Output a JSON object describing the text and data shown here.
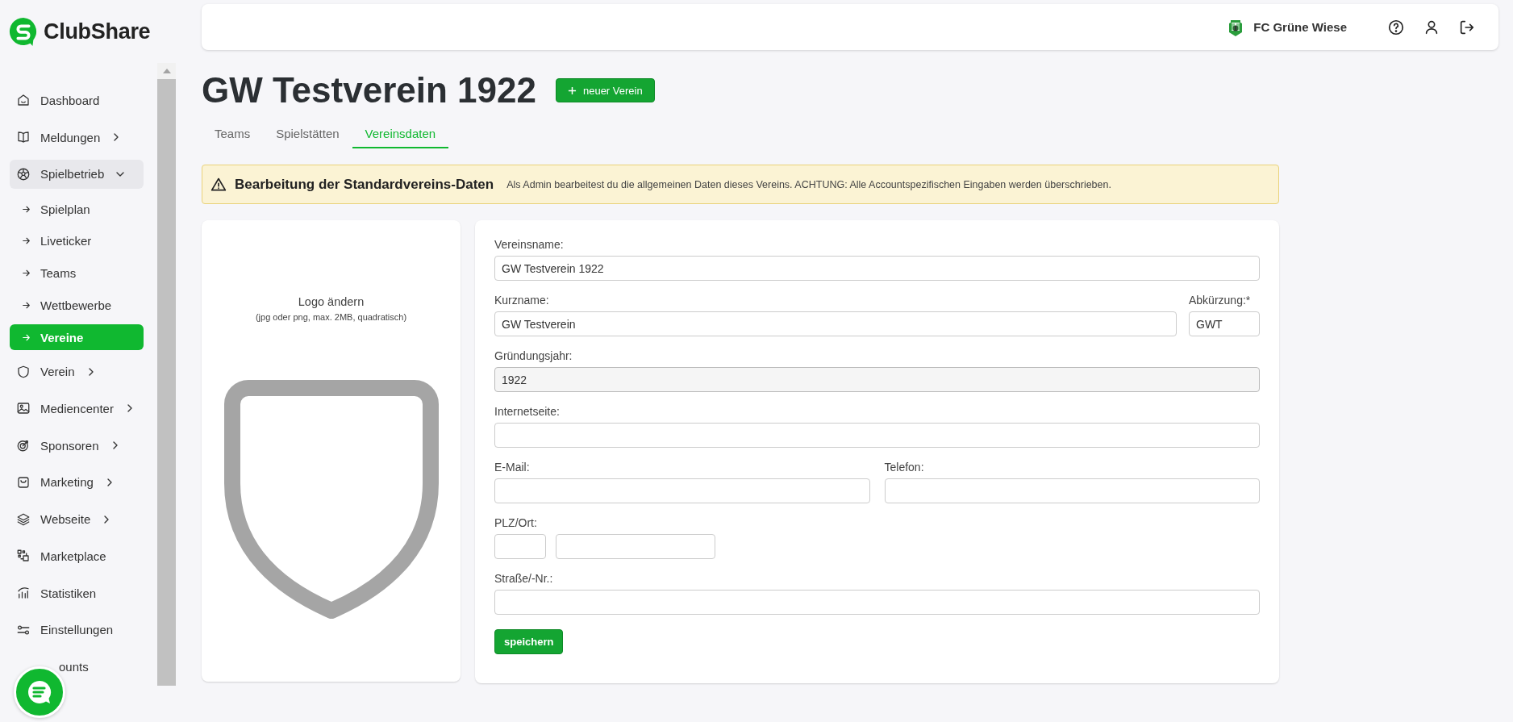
{
  "brand": {
    "name": "ClubShare"
  },
  "header": {
    "club": "FC Grüne Wiese"
  },
  "sidebar": {
    "items": [
      {
        "label": "Dashboard",
        "selected": false
      },
      {
        "label": "Meldungen",
        "selected": false,
        "expanded": false
      },
      {
        "label": "Spielbetrieb",
        "selected": false,
        "expanded": true,
        "children": [
          {
            "label": "Spielplan",
            "selected": false
          },
          {
            "label": "Liveticker",
            "selected": false
          },
          {
            "label": "Teams",
            "selected": false
          },
          {
            "label": "Wettbewerbe",
            "selected": false
          },
          {
            "label": "Vereine",
            "selected": true
          }
        ]
      },
      {
        "label": "Verein",
        "selected": false,
        "expanded": false
      },
      {
        "label": "Mediencenter",
        "selected": false,
        "expanded": false
      },
      {
        "label": "Sponsoren",
        "selected": false,
        "expanded": false
      },
      {
        "label": "Marketing",
        "selected": false,
        "expanded": false
      },
      {
        "label": "Webseite",
        "selected": false,
        "expanded": false
      },
      {
        "label": "Marketplace",
        "selected": false
      },
      {
        "label": "Statistiken",
        "selected": false
      },
      {
        "label": "Einstellungen",
        "selected": false
      },
      {
        "label": "ounts",
        "selected": false
      }
    ]
  },
  "page": {
    "title": "GW Testverein 1922",
    "new_button": "neuer Verein"
  },
  "tabs": [
    {
      "label": "Teams",
      "selected": false
    },
    {
      "label": "Spielstätten",
      "selected": false
    },
    {
      "label": "Vereinsdaten",
      "selected": true
    }
  ],
  "alert": {
    "title": "Bearbeitung der Standardvereins-Daten",
    "text": "Als Admin bearbeitest du die allgemeinen Daten dieses Vereins. ACHTUNG: Alle Accountspezifischen Eingaben werden überschrieben."
  },
  "logo_card": {
    "title": "Logo ändern",
    "hint": "(jpg oder png, max. 2MB, quadratisch)"
  },
  "form": {
    "rows": [
      {
        "kind": "full",
        "fields": [
          {
            "label": "Vereinsname:",
            "value": "GW Testverein 1922",
            "disabled": false
          }
        ]
      },
      {
        "kind": "wide-narrow",
        "fields": [
          {
            "label": "Kurzname:",
            "value": "GW Testverein",
            "disabled": false
          },
          {
            "label": "Abkürzung:*",
            "value": "GWT",
            "disabled": false
          }
        ]
      },
      {
        "kind": "full",
        "fields": [
          {
            "label": "Gründungsjahr:",
            "value": "1922",
            "disabled": true
          }
        ]
      },
      {
        "kind": "full",
        "fields": [
          {
            "label": "Internetseite:",
            "disabled": false
          }
        ]
      },
      {
        "kind": "half",
        "fields": [
          {
            "label": "E-Mail:",
            "disabled": false
          },
          {
            "label": "Telefon:",
            "disabled": false
          }
        ]
      },
      {
        "kind": "zip-city",
        "label": "PLZ/Ort:",
        "fields": [
          {
            "disabled": false
          },
          {
            "disabled": false
          }
        ]
      },
      {
        "kind": "full",
        "fields": [
          {
            "label": "Straße/-Nr.:",
            "disabled": false
          }
        ]
      }
    ],
    "save_button": "speichern"
  }
}
